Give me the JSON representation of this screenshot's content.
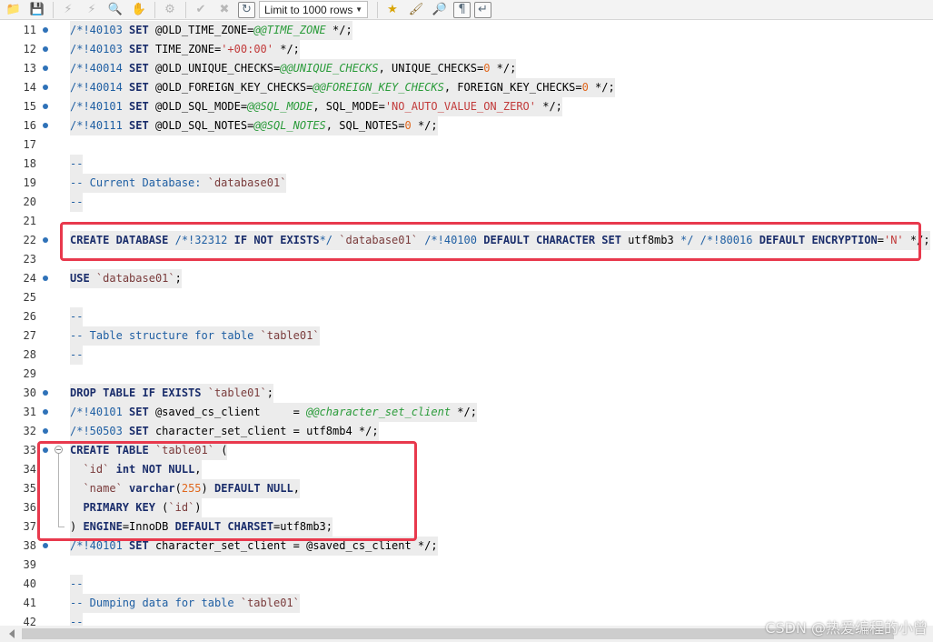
{
  "toolbar": {
    "limit_select_value": "Limit to 1000 rows",
    "icons": [
      "open-folder-icon",
      "save-icon",
      "execute-icon",
      "execute-current-icon",
      "explain-icon",
      "stop-icon",
      "toggle-results-icon",
      "commit-icon",
      "rollback-icon",
      "autocommit-icon",
      "add-snippet-icon",
      "beautify-icon",
      "find-icon",
      "invisibles-icon",
      "wrap-icon"
    ]
  },
  "editor": {
    "lines": [
      {
        "n": "11",
        "marker": true,
        "tokens": [
          {
            "c": "c",
            "t": "/*!40103 "
          },
          {
            "c": "k",
            "t": "SET"
          },
          {
            "c": "id",
            "t": " @OLD_TIME_ZONE="
          },
          {
            "c": "var",
            "t": "@@TIME_ZONE"
          },
          {
            "c": "id",
            "t": " */;"
          }
        ]
      },
      {
        "n": "12",
        "marker": true,
        "tokens": [
          {
            "c": "c",
            "t": "/*!40103 "
          },
          {
            "c": "k",
            "t": "SET"
          },
          {
            "c": "id",
            "t": " TIME_ZONE="
          },
          {
            "c": "str",
            "t": "'+00:00'"
          },
          {
            "c": "id",
            "t": " */;"
          }
        ]
      },
      {
        "n": "13",
        "marker": true,
        "tokens": [
          {
            "c": "c",
            "t": "/*!40014 "
          },
          {
            "c": "k",
            "t": "SET"
          },
          {
            "c": "id",
            "t": " @OLD_UNIQUE_CHECKS="
          },
          {
            "c": "var",
            "t": "@@UNIQUE_CHECKS"
          },
          {
            "c": "id",
            "t": ", UNIQUE_CHECKS="
          },
          {
            "c": "num",
            "t": "0"
          },
          {
            "c": "id",
            "t": " */;"
          }
        ]
      },
      {
        "n": "14",
        "marker": true,
        "tokens": [
          {
            "c": "c",
            "t": "/*!40014 "
          },
          {
            "c": "k",
            "t": "SET"
          },
          {
            "c": "id",
            "t": " @OLD_FOREIGN_KEY_CHECKS="
          },
          {
            "c": "var",
            "t": "@@FOREIGN_KEY_CHECKS"
          },
          {
            "c": "id",
            "t": ", FOREIGN_KEY_CHECKS="
          },
          {
            "c": "num",
            "t": "0"
          },
          {
            "c": "id",
            "t": " */;"
          }
        ]
      },
      {
        "n": "15",
        "marker": true,
        "tokens": [
          {
            "c": "c",
            "t": "/*!40101 "
          },
          {
            "c": "k",
            "t": "SET"
          },
          {
            "c": "id",
            "t": " @OLD_SQL_MODE="
          },
          {
            "c": "var",
            "t": "@@SQL_MODE"
          },
          {
            "c": "id",
            "t": ", SQL_MODE="
          },
          {
            "c": "str",
            "t": "'NO_AUTO_VALUE_ON_ZERO'"
          },
          {
            "c": "id",
            "t": " */;"
          }
        ]
      },
      {
        "n": "16",
        "marker": true,
        "tokens": [
          {
            "c": "c",
            "t": "/*!40111 "
          },
          {
            "c": "k",
            "t": "SET"
          },
          {
            "c": "id",
            "t": " @OLD_SQL_NOTES="
          },
          {
            "c": "var",
            "t": "@@SQL_NOTES"
          },
          {
            "c": "id",
            "t": ", SQL_NOTES="
          },
          {
            "c": "num",
            "t": "0"
          },
          {
            "c": "id",
            "t": " */;"
          }
        ]
      },
      {
        "n": "17",
        "marker": false,
        "tokens": []
      },
      {
        "n": "18",
        "marker": false,
        "tokens": [
          {
            "c": "c",
            "t": "--"
          }
        ]
      },
      {
        "n": "19",
        "marker": false,
        "tokens": [
          {
            "c": "c",
            "t": "-- Current Database: "
          },
          {
            "c": "bt",
            "t": "`database01`"
          }
        ]
      },
      {
        "n": "20",
        "marker": false,
        "tokens": [
          {
            "c": "c",
            "t": "--"
          }
        ]
      },
      {
        "n": "21",
        "marker": false,
        "tokens": []
      },
      {
        "n": "22",
        "marker": true,
        "tokens": [
          {
            "c": "k",
            "t": "CREATE DATABASE"
          },
          {
            "c": "id",
            "t": " "
          },
          {
            "c": "c",
            "t": "/*!32312 "
          },
          {
            "c": "k",
            "t": "IF NOT EXISTS"
          },
          {
            "c": "c",
            "t": "*/"
          },
          {
            "c": "id",
            "t": " "
          },
          {
            "c": "bt",
            "t": "`database01`"
          },
          {
            "c": "id",
            "t": " "
          },
          {
            "c": "c",
            "t": "/*!40100 "
          },
          {
            "c": "k",
            "t": "DEFAULT CHARACTER SET"
          },
          {
            "c": "id",
            "t": " utf8mb3 "
          },
          {
            "c": "c",
            "t": "*/"
          },
          {
            "c": "id",
            "t": " "
          },
          {
            "c": "c",
            "t": "/*!80016 "
          },
          {
            "c": "k",
            "t": "DEFAULT ENCRYPTION"
          },
          {
            "c": "id",
            "t": "="
          },
          {
            "c": "str",
            "t": "'N'"
          },
          {
            "c": "id",
            "t": " */;"
          }
        ]
      },
      {
        "n": "23",
        "marker": false,
        "tokens": []
      },
      {
        "n": "24",
        "marker": true,
        "tokens": [
          {
            "c": "k",
            "t": "USE"
          },
          {
            "c": "id",
            "t": " "
          },
          {
            "c": "bt",
            "t": "`database01`"
          },
          {
            "c": "id",
            "t": ";"
          }
        ]
      },
      {
        "n": "25",
        "marker": false,
        "tokens": []
      },
      {
        "n": "26",
        "marker": false,
        "tokens": [
          {
            "c": "c",
            "t": "--"
          }
        ]
      },
      {
        "n": "27",
        "marker": false,
        "tokens": [
          {
            "c": "c",
            "t": "-- Table structure for table "
          },
          {
            "c": "bt",
            "t": "`table01`"
          }
        ]
      },
      {
        "n": "28",
        "marker": false,
        "tokens": [
          {
            "c": "c",
            "t": "--"
          }
        ]
      },
      {
        "n": "29",
        "marker": false,
        "tokens": []
      },
      {
        "n": "30",
        "marker": true,
        "tokens": [
          {
            "c": "k",
            "t": "DROP TABLE IF EXISTS"
          },
          {
            "c": "id",
            "t": " "
          },
          {
            "c": "bt",
            "t": "`table01`"
          },
          {
            "c": "id",
            "t": ";"
          }
        ]
      },
      {
        "n": "31",
        "marker": true,
        "tokens": [
          {
            "c": "c",
            "t": "/*!40101 "
          },
          {
            "c": "k",
            "t": "SET"
          },
          {
            "c": "id",
            "t": " @saved_cs_client     = "
          },
          {
            "c": "var",
            "t": "@@character_set_client"
          },
          {
            "c": "id",
            "t": " */;"
          }
        ]
      },
      {
        "n": "32",
        "marker": true,
        "tokens": [
          {
            "c": "c",
            "t": "/*!50503 "
          },
          {
            "c": "k",
            "t": "SET"
          },
          {
            "c": "id",
            "t": " character_set_client = utf8mb4 */;"
          }
        ]
      },
      {
        "n": "33",
        "marker": true,
        "fold": "start",
        "tokens": [
          {
            "c": "k",
            "t": "CREATE TABLE"
          },
          {
            "c": "id",
            "t": " "
          },
          {
            "c": "bt",
            "t": "`table01`"
          },
          {
            "c": "id",
            "t": " ("
          }
        ]
      },
      {
        "n": "34",
        "marker": false,
        "fold": "mid",
        "tokens": [
          {
            "c": "id",
            "t": "  "
          },
          {
            "c": "bt",
            "t": "`id`"
          },
          {
            "c": "id",
            "t": " "
          },
          {
            "c": "k",
            "t": "int NOT NULL"
          },
          {
            "c": "id",
            "t": ","
          }
        ]
      },
      {
        "n": "35",
        "marker": false,
        "fold": "mid",
        "tokens": [
          {
            "c": "id",
            "t": "  "
          },
          {
            "c": "bt",
            "t": "`name`"
          },
          {
            "c": "id",
            "t": " "
          },
          {
            "c": "k",
            "t": "varchar"
          },
          {
            "c": "id",
            "t": "("
          },
          {
            "c": "num",
            "t": "255"
          },
          {
            "c": "id",
            "t": ") "
          },
          {
            "c": "k",
            "t": "DEFAULT NULL"
          },
          {
            "c": "id",
            "t": ","
          }
        ]
      },
      {
        "n": "36",
        "marker": false,
        "fold": "mid",
        "tokens": [
          {
            "c": "id",
            "t": "  "
          },
          {
            "c": "k",
            "t": "PRIMARY KEY"
          },
          {
            "c": "id",
            "t": " ("
          },
          {
            "c": "bt",
            "t": "`id`"
          },
          {
            "c": "id",
            "t": ")"
          }
        ]
      },
      {
        "n": "37",
        "marker": false,
        "fold": "end",
        "tokens": [
          {
            "c": "id",
            "t": ") "
          },
          {
            "c": "k",
            "t": "ENGINE"
          },
          {
            "c": "id",
            "t": "=InnoDB "
          },
          {
            "c": "k",
            "t": "DEFAULT CHARSET"
          },
          {
            "c": "id",
            "t": "=utf8mb3;"
          }
        ]
      },
      {
        "n": "38",
        "marker": true,
        "tokens": [
          {
            "c": "c",
            "t": "/*!40101 "
          },
          {
            "c": "k",
            "t": "SET"
          },
          {
            "c": "id",
            "t": " character_set_client = @saved_cs_client */;"
          }
        ]
      },
      {
        "n": "39",
        "marker": false,
        "tokens": []
      },
      {
        "n": "40",
        "marker": false,
        "tokens": [
          {
            "c": "c",
            "t": "--"
          }
        ]
      },
      {
        "n": "41",
        "marker": false,
        "tokens": [
          {
            "c": "c",
            "t": "-- Dumping data for table "
          },
          {
            "c": "bt",
            "t": "`table01`"
          }
        ]
      },
      {
        "n": "42",
        "marker": false,
        "tokens": [
          {
            "c": "c",
            "t": "--"
          }
        ]
      }
    ]
  },
  "colors": {
    "annotation": "#e8394d",
    "marker": "#2f72b8"
  },
  "watermark": "CSDN @热爱编程的小曾"
}
